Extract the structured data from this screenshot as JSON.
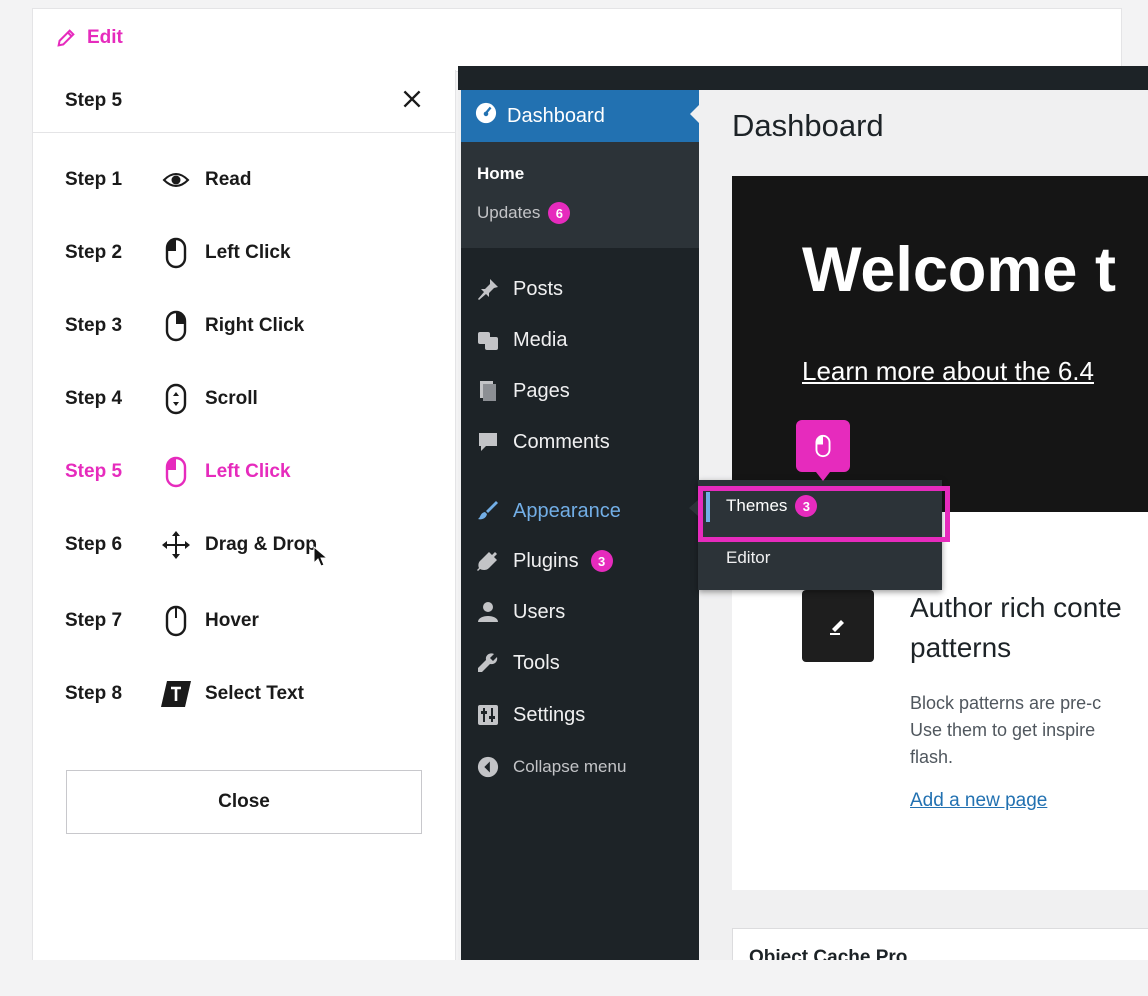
{
  "topbar": {
    "edit_label": "Edit"
  },
  "panel": {
    "title": "Step 5",
    "steps": [
      {
        "step": "Step 1",
        "action": "Read",
        "icon": "eye-icon"
      },
      {
        "step": "Step 2",
        "action": "Left Click",
        "icon": "mouse-left-click-icon"
      },
      {
        "step": "Step 3",
        "action": "Right Click",
        "icon": "mouse-right-click-icon"
      },
      {
        "step": "Step 4",
        "action": "Scroll",
        "icon": "mouse-scroll-icon"
      },
      {
        "step": "Step 5",
        "action": "Left Click",
        "icon": "mouse-left-click-icon"
      },
      {
        "step": "Step 6",
        "action": "Drag & Drop",
        "icon": "move-arrows-icon"
      },
      {
        "step": "Step 7",
        "action": "Hover",
        "icon": "mouse-icon"
      },
      {
        "step": "Step 8",
        "action": "Select Text",
        "icon": "text-select-icon"
      }
    ],
    "close_label": "Close"
  },
  "colors": {
    "accent": "#e62bbd",
    "wp_sidebar": "#1d2327",
    "wp_active": "#2271b1",
    "wp_link": "#72aee6"
  },
  "wp": {
    "sidebar": {
      "dashboard": "Dashboard",
      "home": "Home",
      "updates": "Updates",
      "updates_count": "6",
      "posts": "Posts",
      "media": "Media",
      "pages": "Pages",
      "comments": "Comments",
      "appearance": "Appearance",
      "plugins": "Plugins",
      "plugins_count": "3",
      "users": "Users",
      "tools": "Tools",
      "settings": "Settings",
      "collapse": "Collapse menu"
    },
    "flyout": {
      "themes": "Themes",
      "themes_count": "3",
      "editor": "Editor"
    },
    "main": {
      "title": "Dashboard",
      "welcome_heading": "Welcome t",
      "welcome_link": "Learn more about the 6.4",
      "card_heading_line1": "Author rich conte",
      "card_heading_line2": "patterns",
      "card_text_line1": "Block patterns are pre-c",
      "card_text_line2": "Use them to get inspire",
      "card_text_line3": "flash.",
      "card_link": "Add a new page",
      "cache_title": "Object Cache Pro"
    }
  }
}
